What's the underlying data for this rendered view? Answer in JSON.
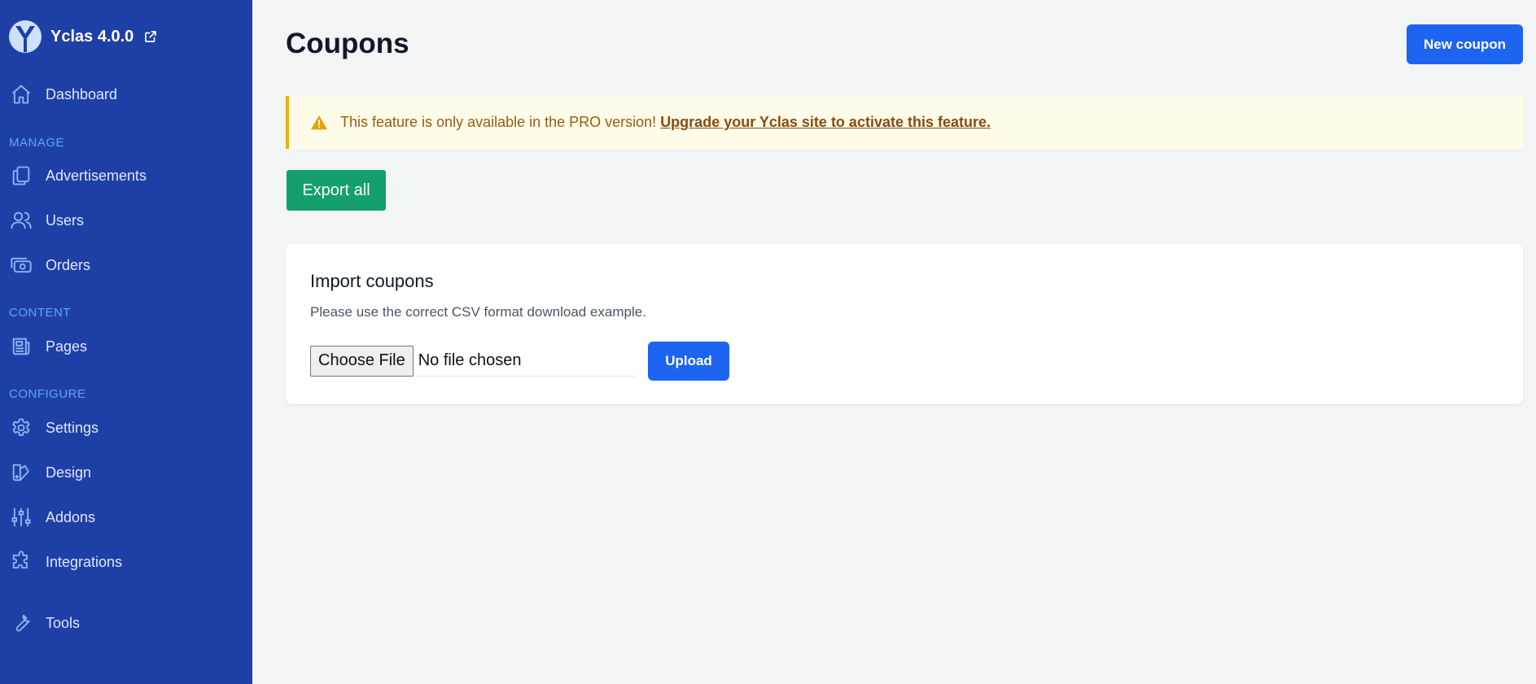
{
  "app": {
    "name": "Yclas 4.0.0",
    "logo_icon": "yclas-logo-icon",
    "external_icon": "external-link-icon"
  },
  "sidebar": {
    "dashboard": {
      "label": "Dashboard",
      "icon": "home-icon"
    },
    "sections": {
      "manage": "MANAGE",
      "content": "CONTENT",
      "configure": "CONFIGURE"
    },
    "manage_items": [
      {
        "label": "Advertisements",
        "icon": "documents-icon"
      },
      {
        "label": "Users",
        "icon": "users-icon"
      },
      {
        "label": "Orders",
        "icon": "cash-icon"
      }
    ],
    "content_items": [
      {
        "label": "Pages",
        "icon": "newspaper-icon"
      }
    ],
    "configure_items": [
      {
        "label": "Settings",
        "icon": "gear-icon"
      },
      {
        "label": "Design",
        "icon": "palette-icon"
      },
      {
        "label": "Addons",
        "icon": "sliders-icon"
      },
      {
        "label": "Integrations",
        "icon": "puzzle-icon"
      }
    ],
    "tools": {
      "label": "Tools",
      "icon": "wrench-icon"
    }
  },
  "header": {
    "title": "Coupons",
    "new_coupon_label": "New coupon"
  },
  "alert": {
    "text": "This feature is only available in the PRO version!",
    "link_text": "Upgrade your Yclas site to activate this feature.",
    "icon": "warning-icon"
  },
  "actions": {
    "export_label": "Export all"
  },
  "import_card": {
    "title": "Import coupons",
    "description": "Please use the correct CSV format download example.",
    "choose_file_label": "Choose File",
    "file_status": "No file chosen",
    "upload_label": "Upload"
  },
  "colors": {
    "sidebar_bg": "#1e40a6",
    "primary": "#1d64f0",
    "success": "#13a06c",
    "warning_bg": "#fefce8",
    "warning_border": "#e8b015"
  }
}
